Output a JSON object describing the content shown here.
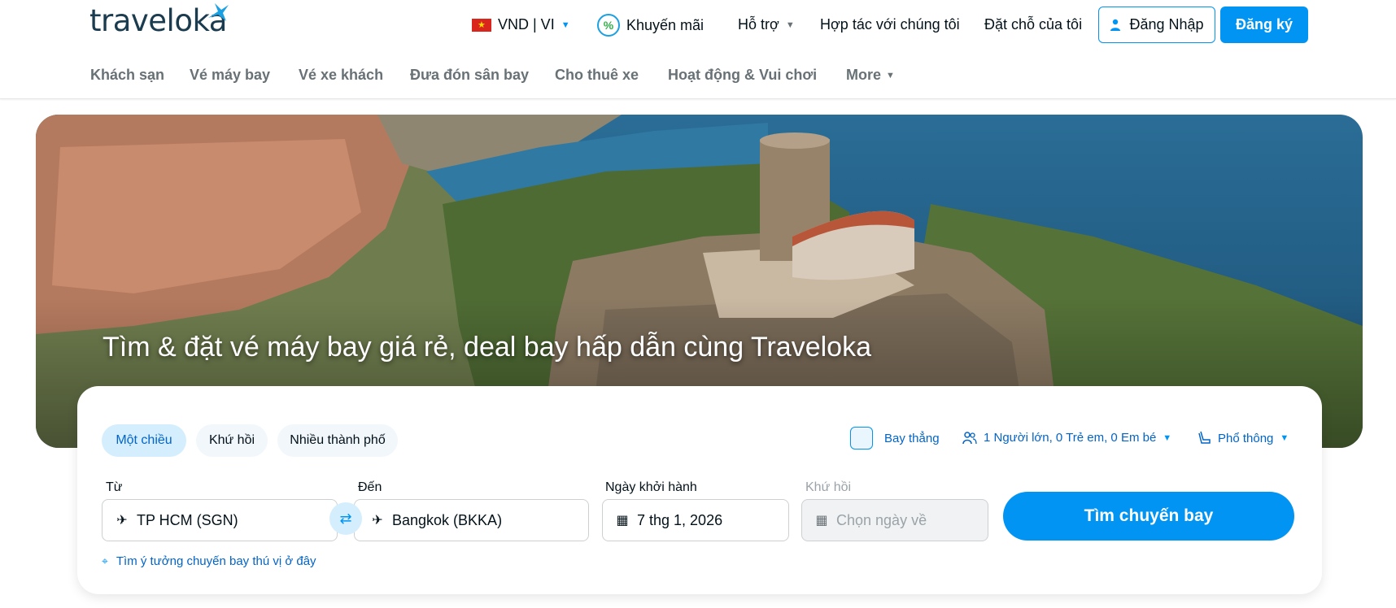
{
  "header": {
    "logo_text": "traveloka",
    "currency_lang": "VND | VI",
    "promo": "Khuyến mãi",
    "support": "Hỗ trợ",
    "partner": "Hợp tác với chúng tôi",
    "bookings": "Đặt chỗ của tôi",
    "login": "Đăng Nhập",
    "register": "Đăng ký"
  },
  "nav": {
    "items": [
      "Khách sạn",
      "Vé máy bay",
      "Vé xe khách",
      "Đưa đón sân bay",
      "Cho thuê xe",
      "Hoạt động & Vui chơi"
    ],
    "more": "More"
  },
  "hero": {
    "title": "Tìm & đặt vé máy bay giá rẻ, deal bay hấp dẫn cùng Traveloka"
  },
  "search": {
    "trip_types": [
      "Một chiều",
      "Khứ hồi",
      "Nhiều thành phố"
    ],
    "active_trip_type": "Một chiều",
    "direct_flight": "Bay thẳng",
    "passengers": "1 Người lớn, 0 Trẻ em, 0 Em bé",
    "seat_class": "Phổ thông",
    "from_label": "Từ",
    "from_value": "TP HCM (SGN)",
    "to_label": "Đến",
    "to_value": "Bangkok (BKKA)",
    "depart_label": "Ngày khởi hành",
    "depart_value": "7 thg 1, 2026",
    "return_label": "Khứ hồi",
    "return_placeholder": "Chọn ngày về",
    "search_button": "Tìm chuyến bay",
    "idea_link": "Tìm ý tưởng chuyến bay thú vị ở đây"
  },
  "colors": {
    "brand_blue": "#0194f3",
    "link_blue": "#0264c8",
    "active_pill_bg": "#d5eefe"
  }
}
